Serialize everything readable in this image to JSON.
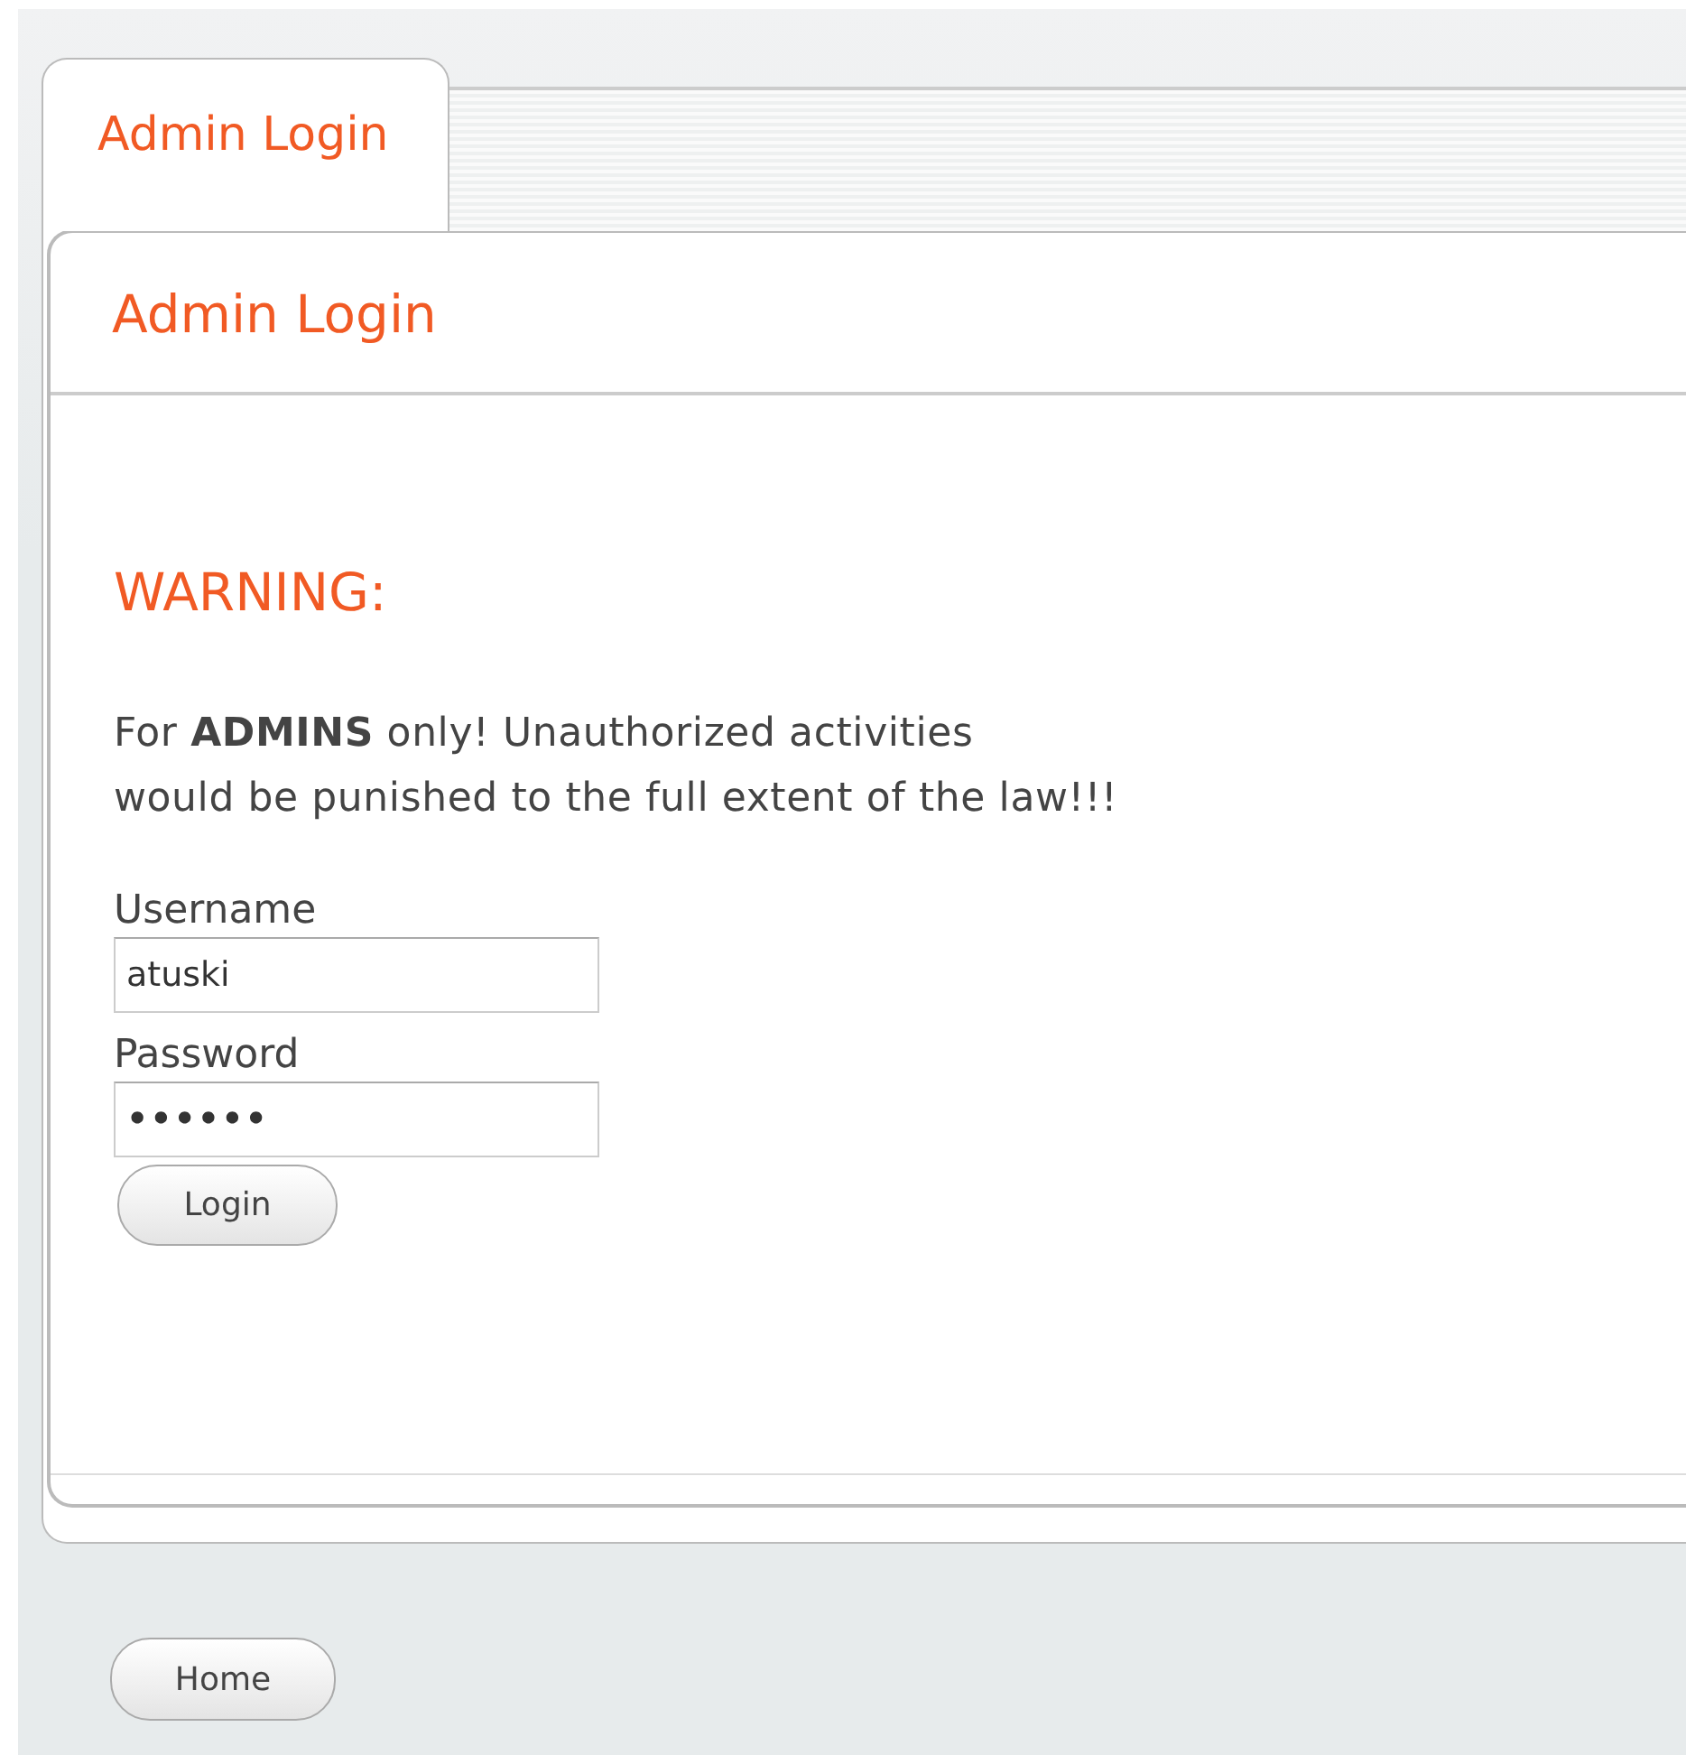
{
  "tabs": [
    {
      "label": "Admin Login",
      "selected": true
    }
  ],
  "panel": {
    "title": "Admin Login",
    "warning": {
      "heading": "WARNING:",
      "message": "For **ADMINS** only! Unauthorized activities\nwould be punished to the full extent of the law!!!"
    },
    "form": {
      "fields": [
        {
          "label": "Username",
          "kind": "text",
          "value": "atuski"
        },
        {
          "label": "Password",
          "kind": "password",
          "value": "••••••"
        }
      ],
      "submit": "Login"
    }
  },
  "footer": {
    "button": "Home"
  }
}
